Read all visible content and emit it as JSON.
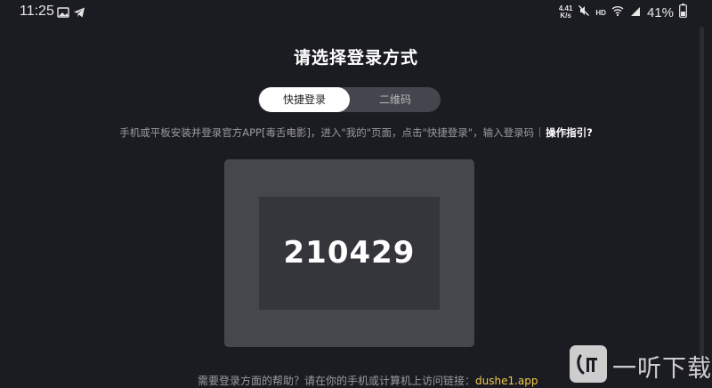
{
  "status_bar": {
    "time": "11:25",
    "net_speed": "4.41",
    "net_speed_unit": "K/s",
    "hd_label": "HD",
    "battery": "41%",
    "icons": [
      "gallery-icon",
      "telegram-icon",
      "mute-icon",
      "wifi-icon",
      "signal-icon",
      "battery-icon"
    ]
  },
  "login": {
    "title": "请选择登录方式",
    "tabs": [
      {
        "label": "快捷登录",
        "active": true
      },
      {
        "label": "二维码",
        "active": false
      }
    ],
    "instruction": "手机或平板安装并登录官方APP[毒舌电影]，进入\"我的\"页面，点击\"快捷登录\"，输入登录码",
    "guide_link": "操作指引?",
    "code": "210429",
    "footer_text": "需要登录方面的帮助？请在你的手机或计算机上访问链接：",
    "footer_link": "dushe1.app"
  },
  "watermark": {
    "text": "一听下载"
  },
  "colors": {
    "background": "#1b1c22",
    "card": "#46474d",
    "code_box": "#35363c",
    "tab_track": "#45464d",
    "link": "#f2c94c"
  }
}
